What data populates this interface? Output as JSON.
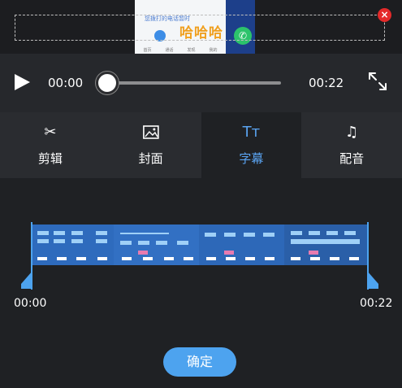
{
  "preview": {
    "caption_text": "哈哈哈",
    "small_text": "您拨打的电话暂时",
    "nav_labels": [
      "首页",
      "通话",
      "发现",
      "我的"
    ]
  },
  "player": {
    "current_time": "00:00",
    "total_time": "00:22",
    "progress": 0
  },
  "tabs": [
    {
      "label": "剪辑",
      "icon": "scissors-icon",
      "glyph": "✂"
    },
    {
      "label": "封面",
      "icon": "image-icon",
      "glyph": ""
    },
    {
      "label": "字幕",
      "icon": "text-size-icon",
      "glyph": "Tт"
    },
    {
      "label": "配音",
      "icon": "music-note-icon",
      "glyph": "♫"
    }
  ],
  "active_tab": "字幕",
  "timeline": {
    "start_label": "00:00",
    "end_label": "00:22"
  },
  "confirm_label": "确定",
  "colors": {
    "accent": "#4da3ef",
    "caption": "#f0a020",
    "close": "#e42a2a",
    "background": "#1f2124"
  }
}
